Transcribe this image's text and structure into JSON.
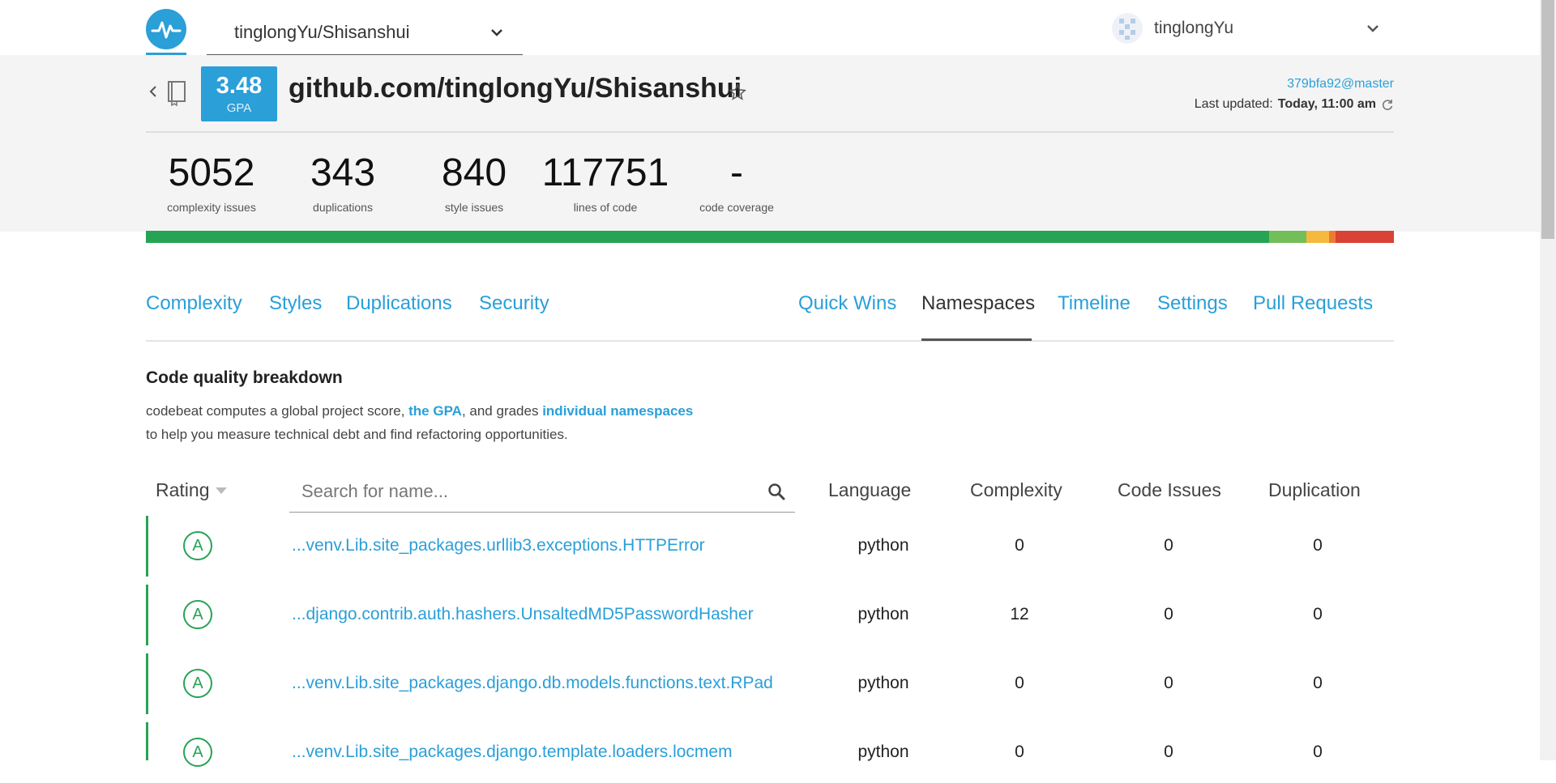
{
  "topbar": {
    "repo_selector": "tinglongYu/Shisanshui",
    "user_name": "tinglongYu"
  },
  "header": {
    "gpa_value": "3.48",
    "gpa_label": "GPA",
    "repo_title": "github.com/tinglongYu/Shisanshui",
    "commit": "379bfa92@master",
    "last_updated_label": "Last updated:",
    "last_updated_value": "Today, 11:00 am"
  },
  "stats": [
    {
      "value": "5052",
      "label": "complexity issues"
    },
    {
      "value": "343",
      "label": "duplications"
    },
    {
      "value": "840",
      "label": "style issues"
    },
    {
      "value": "117751",
      "label": "lines of code"
    },
    {
      "value": "-",
      "label": "code coverage"
    }
  ],
  "grade_distribution": [
    {
      "grade": "A",
      "fraction": 0.9,
      "color": "#27a354"
    },
    {
      "grade": "B",
      "fraction": 0.03,
      "color": "#72bf5a"
    },
    {
      "grade": "C",
      "fraction": 0.018,
      "color": "#f5b93e"
    },
    {
      "grade": "D",
      "fraction": 0.005,
      "color": "#ee7b32"
    },
    {
      "grade": "F",
      "fraction": 0.047,
      "color": "#d94234"
    }
  ],
  "tabs": [
    {
      "label": "Complexity"
    },
    {
      "label": "Styles"
    },
    {
      "label": "Duplications"
    },
    {
      "label": "Security"
    },
    {
      "label": "Quick Wins"
    },
    {
      "label": "Namespaces",
      "active": true
    },
    {
      "label": "Timeline"
    },
    {
      "label": "Settings"
    },
    {
      "label": "Pull Requests"
    }
  ],
  "section": {
    "title": "Code quality breakdown",
    "desc_part1": "codebeat computes a global project score, ",
    "link_gpa": "the GPA",
    "desc_part2": ", and grades ",
    "link_namespaces": "individual namespaces",
    "desc_line2": "to help you measure technical debt and find refactoring opportunities."
  },
  "table": {
    "col_rating": "Rating",
    "search_placeholder": "Search for name...",
    "col_language": "Language",
    "col_complexity": "Complexity",
    "col_issues": "Code Issues",
    "col_duplication": "Duplication",
    "rows": [
      {
        "grade": "A",
        "name": "...venv.Lib.site_packages.urllib3.exceptions.HTTPError",
        "language": "python",
        "complexity": "0",
        "issues": "0",
        "duplication": "0"
      },
      {
        "grade": "A",
        "name": "...django.contrib.auth.hashers.UnsaltedMD5PasswordHasher",
        "language": "python",
        "complexity": "12",
        "issues": "0",
        "duplication": "0"
      },
      {
        "grade": "A",
        "name": "...venv.Lib.site_packages.django.db.models.functions.text.RPad",
        "language": "python",
        "complexity": "0",
        "issues": "0",
        "duplication": "0"
      },
      {
        "grade": "A",
        "name": "...venv.Lib.site_packages.django.template.loaders.locmem",
        "language": "python",
        "complexity": "0",
        "issues": "0",
        "duplication": "0"
      }
    ]
  }
}
